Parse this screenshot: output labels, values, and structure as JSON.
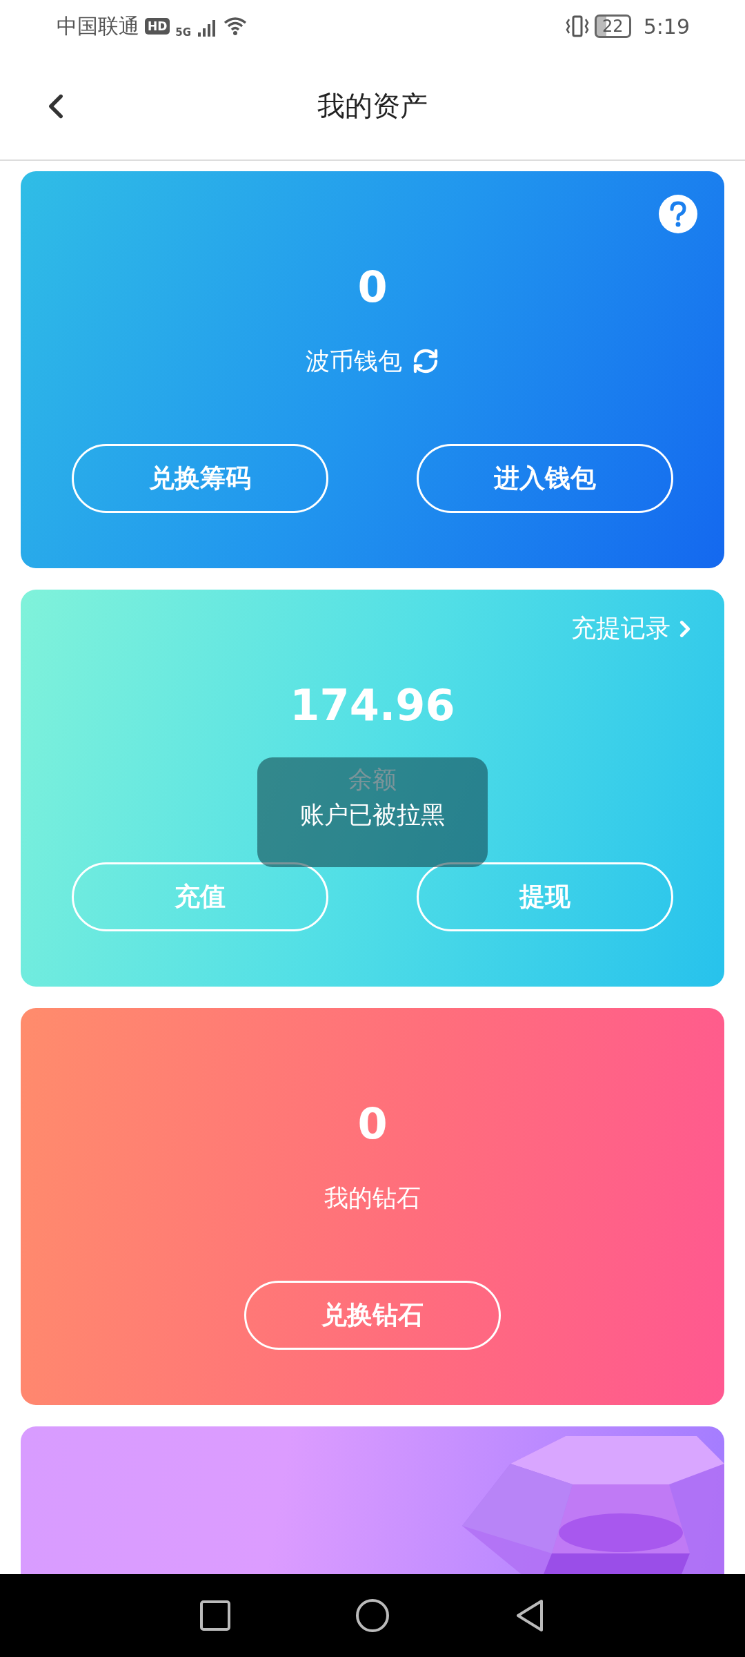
{
  "status_bar": {
    "carrier": "中国联通",
    "network_badge": "HD",
    "network_type": "5G",
    "battery": "22",
    "time": "5:19"
  },
  "header": {
    "title": "我的资产"
  },
  "cards": [
    {
      "kind": "wallet",
      "value": "0",
      "label": "波币钱包",
      "buttons": [
        "兑换筹码",
        "进入钱包"
      ]
    },
    {
      "kind": "balance",
      "value": "174.96",
      "label": "余额",
      "link": "充提记录",
      "buttons": [
        "充值",
        "提现"
      ]
    },
    {
      "kind": "diamond",
      "value": "0",
      "label": "我的钻石",
      "buttons": [
        "兑换钻石"
      ]
    },
    {
      "kind": "gem"
    }
  ],
  "toast": {
    "message": "账户已被拉黑"
  }
}
